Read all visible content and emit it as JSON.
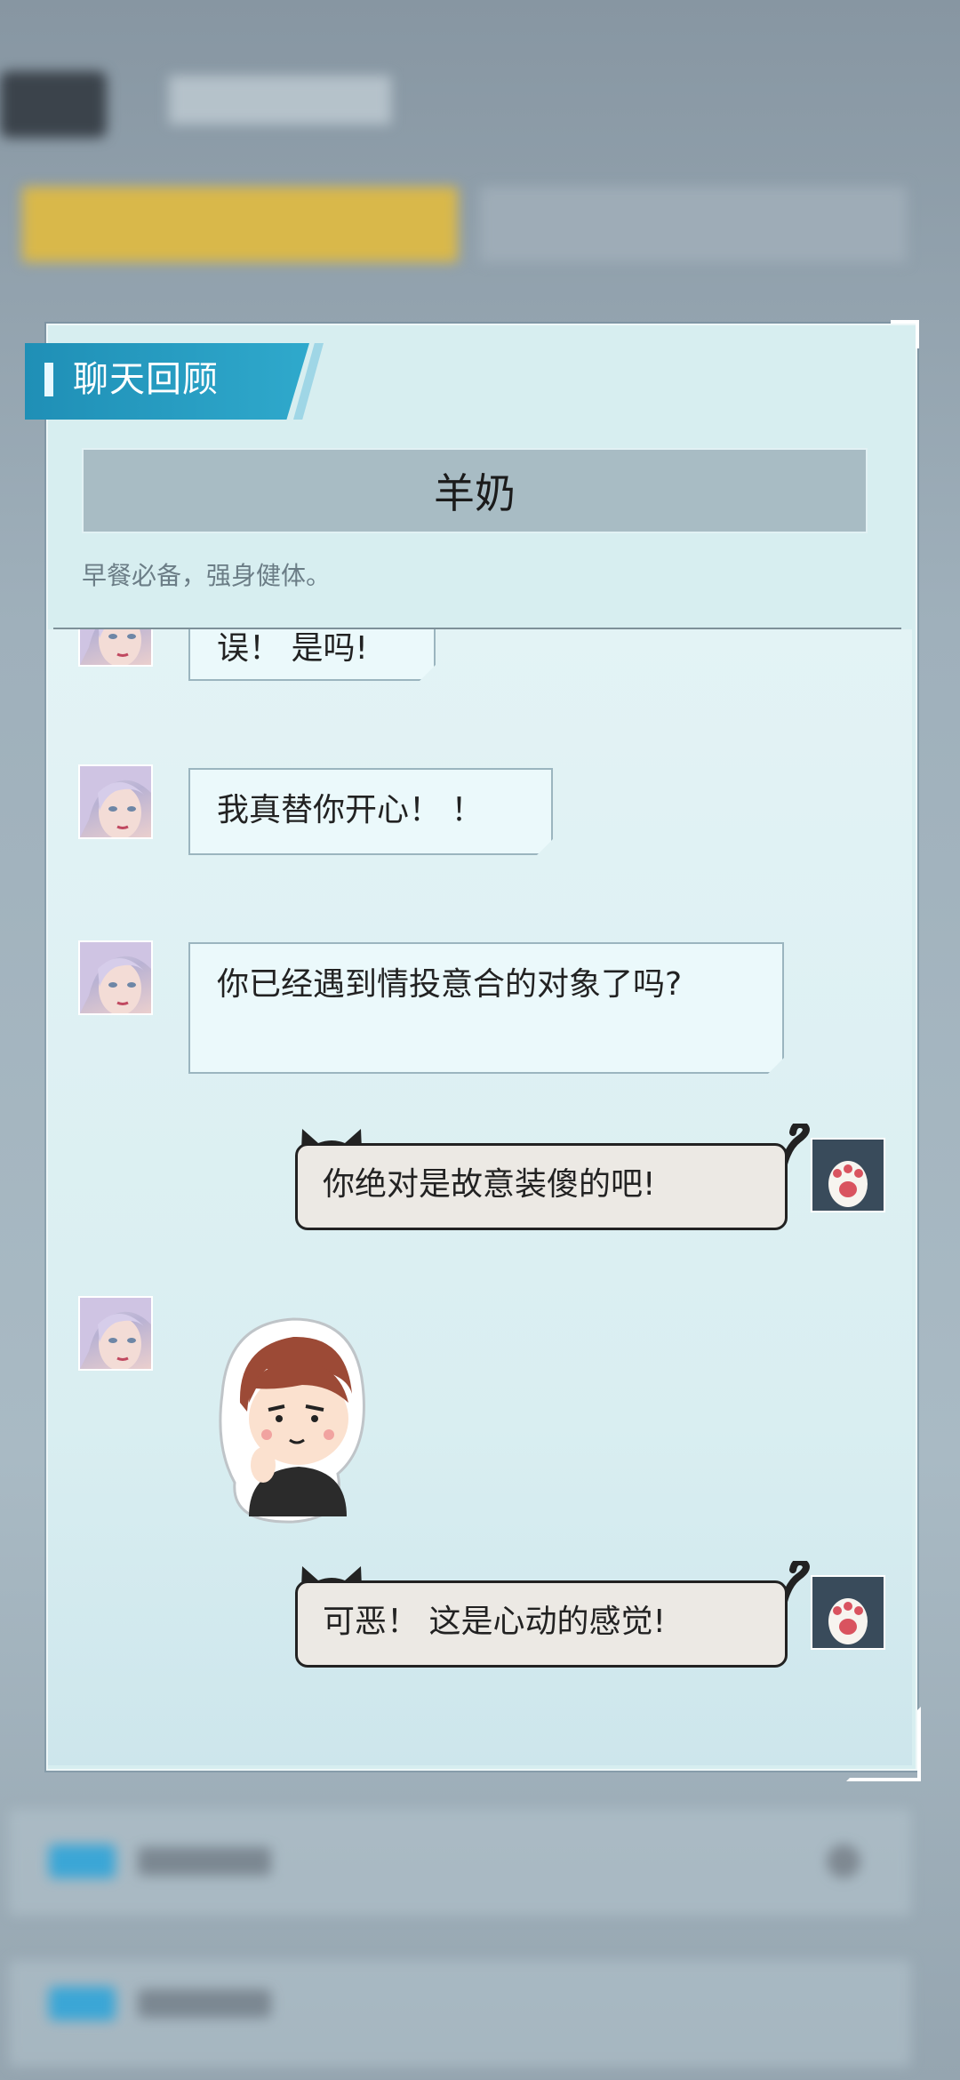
{
  "dialog": {
    "header_title": "聊天回顾",
    "item_name": "羊奶",
    "item_description": "早餐必备，强身健体。"
  },
  "messages": [
    {
      "side": "left",
      "text": "误！ 是吗!",
      "avatar_icon": "girl-avatar-icon"
    },
    {
      "side": "left",
      "text": "我真替你开心！ ！",
      "avatar_icon": "girl-avatar-icon"
    },
    {
      "side": "left",
      "text": "你已经遇到情投意合的对象了吗?",
      "avatar_icon": "girl-avatar-icon"
    },
    {
      "side": "right",
      "text": "你绝对是故意装傻的吧!",
      "avatar_icon": "cat-paw-icon"
    },
    {
      "side": "left",
      "sticker": "boy-thinking-sticker",
      "avatar_icon": "girl-avatar-icon"
    },
    {
      "side": "right",
      "text": "可恶！ 这是心动的感觉!",
      "avatar_icon": "cat-paw-icon"
    }
  ],
  "colors": {
    "header_accent": "#2fa9cc",
    "dialog_bg": "#d7eef0",
    "name_box_bg": "#a8bcc4",
    "bubble_left_bg": "#ebf9fb",
    "bubble_right_bg": "#ece9e4",
    "background_tab_highlight": "#d9b84a"
  }
}
